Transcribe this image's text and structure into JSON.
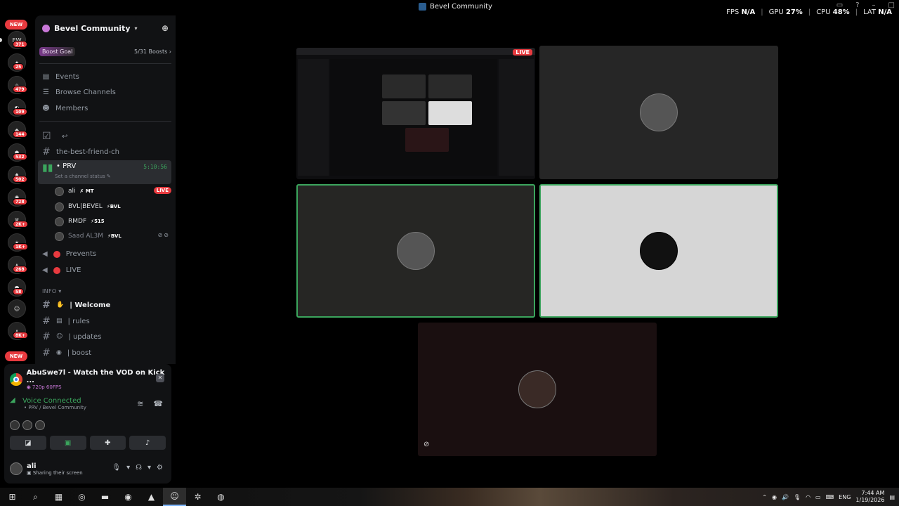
{
  "window": {
    "title": "Bevel Community"
  },
  "perf": {
    "fps_label": "FPS",
    "fps": "N/A",
    "gpu_label": "GPU",
    "gpu": "27",
    "gpu_unit": "%",
    "cpu_label": "CPU",
    "cpu": "48",
    "cpu_unit": "%",
    "lat_label": "LAT",
    "lat": "N/A"
  },
  "rail": {
    "new_top": "NEW",
    "new_bottom": "NEW",
    "counts": [
      "371",
      "25",
      "479",
      "109",
      "144",
      "532",
      "502",
      "728",
      "2K+",
      "1K+",
      "268",
      "58",
      "8K+"
    ]
  },
  "server": {
    "name": "Bevel Community",
    "boost_label": "Boost Goal",
    "boost_progress": "5/31 Boosts"
  },
  "nav": {
    "events": "Events",
    "browse": "Browse Channels",
    "members": "Members"
  },
  "channels": {
    "hidden": "",
    "friend": "the-best-friend-ch",
    "prv": "PRV",
    "prv_timer": "5:10:56",
    "prv_status": "Set a channel status",
    "prevents": "Prevents",
    "live": "LIVE",
    "category": "INFO",
    "welcome": "Welcome",
    "rules": "rules",
    "updates": "updates",
    "boost": "boost"
  },
  "voice_users": [
    {
      "name": "ali",
      "tag": "MT",
      "badge": "LIVE"
    },
    {
      "name": "BVL|BEVEL",
      "tag": "BVL"
    },
    {
      "name": "RMDF",
      "tag": "515"
    },
    {
      "name": "Saad AL3M",
      "tag": "BVL"
    }
  ],
  "stream_card": {
    "title": "AbuSwe7l - Watch the VOD on Kick ...",
    "quality": "720p 60FPS"
  },
  "voice": {
    "status": "Voice Connected",
    "location": "PRV / Bevel Community"
  },
  "me": {
    "name": "ali",
    "status": "Sharing their screen"
  },
  "stage": {
    "live_label": "LIVE"
  },
  "tray": {
    "lang": "ENG",
    "time": "7:44 AM",
    "date": "1/19/2026"
  }
}
